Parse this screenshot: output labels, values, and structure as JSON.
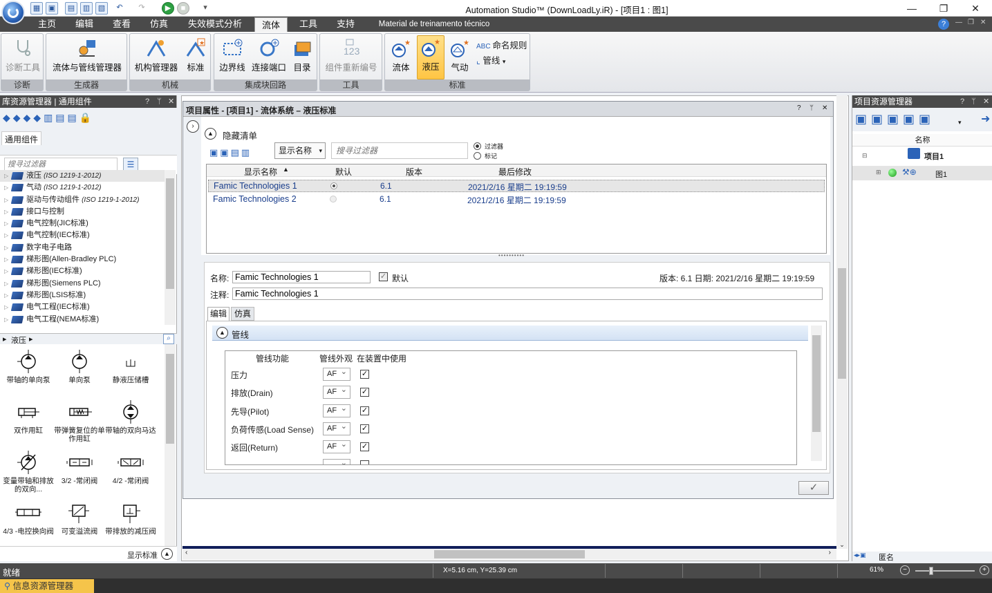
{
  "window": {
    "title": "Automation Studio™ (DownLoadLy.iR) - [项目1 : 图1]"
  },
  "menu": {
    "items": [
      "主页",
      "编辑",
      "查看",
      "仿真",
      "失效模式分析",
      "流体",
      "工具",
      "支持"
    ],
    "active_index": 5,
    "extra": "Material de treinamento técnico"
  },
  "ribbon": {
    "groups": [
      {
        "label": "诊断",
        "buttons": [
          {
            "label": "诊断工具",
            "disabled": true
          }
        ]
      },
      {
        "label": "生成器",
        "buttons": [
          {
            "label": "流体与管线管理器"
          }
        ]
      },
      {
        "label": "机械",
        "buttons": [
          {
            "label": "机构管理器"
          },
          {
            "label": "标准"
          }
        ]
      },
      {
        "label": "集成块回路",
        "buttons": [
          {
            "label": "边界线"
          },
          {
            "label": "连接端口"
          },
          {
            "label": "目录"
          }
        ]
      },
      {
        "label": "工具",
        "buttons": [
          {
            "label": "组件重新编号",
            "disabled": true
          }
        ]
      },
      {
        "label": "标准",
        "buttons": [
          {
            "label": "流体"
          },
          {
            "label": "液压",
            "selected": true
          },
          {
            "label": "气动"
          }
        ],
        "small": [
          "命名规则",
          "管线"
        ]
      }
    ]
  },
  "library": {
    "title": "库资源管理器 | 通用组件",
    "tab": "通用组件",
    "filter_placeholder": "搜寻过滤器",
    "items": [
      {
        "label": "液压",
        "tag": "(ISO 1219-1-2012)",
        "selected": true
      },
      {
        "label": "气动",
        "tag": "(ISO 1219-1-2012)"
      },
      {
        "label": "驱动与传动组件",
        "tag": "(ISO 1219-1-2012)"
      },
      {
        "label": "接口与控制",
        "tag": ""
      },
      {
        "label": "电气控制(JIC标准)",
        "tag": ""
      },
      {
        "label": "电气控制(IEC标准)",
        "tag": ""
      },
      {
        "label": "数字电子电路",
        "tag": ""
      },
      {
        "label": "梯形图(Allen-Bradley PLC)",
        "tag": ""
      },
      {
        "label": "梯形图(IEC标准)",
        "tag": ""
      },
      {
        "label": "梯形图(Siemens PLC)",
        "tag": ""
      },
      {
        "label": "梯形图(LSIS标准)",
        "tag": ""
      },
      {
        "label": "电气工程(IEC标准)",
        "tag": ""
      },
      {
        "label": "电气工程(NEMA标准)",
        "tag": ""
      }
    ],
    "path": "液压",
    "components": [
      "带轴的单向泵",
      "单向泵",
      "静液压储槽",
      "双作用缸",
      "带弹簧复位的单作用缸",
      "带轴的双向马达",
      "变量带轴和排放的双向...",
      "3/2 -常闭阀",
      "4/2 -常闭阀",
      "4/3 -电控换向阀",
      "可变溢流阀",
      "带排放的减压阀"
    ],
    "show_standard": "显示标准"
  },
  "props": {
    "title": "项目属性 - [项目1] - 流体系统 – 液压标准",
    "hide_list": "隐藏清单",
    "display_name_btn": "显示名称",
    "search_placeholder": "搜寻过滤器",
    "radio_filter": "过滤器",
    "radio_mark": "标记",
    "columns": [
      "显示名称",
      "默认",
      "版本",
      "最后修改"
    ],
    "rows": [
      {
        "name": "Famic Technologies 1",
        "version": "6.1",
        "modified": "2021/2/16 星期二 19:19:59",
        "default": true
      },
      {
        "name": "Famic Technologies 2",
        "version": "6.1",
        "modified": "2021/2/16 星期二 19:19:59",
        "default": false
      }
    ],
    "name_label": "名称:",
    "name_value": "Famic Technologies 1",
    "default_label": "默认",
    "version_info": "版本: 6.1 日期: 2021/2/16 星期二 19:19:59",
    "note_label": "注释:",
    "note_value": "Famic Technologies 1",
    "tabs": [
      "编辑",
      "仿真"
    ],
    "section": "管线",
    "line_cols": [
      "管线功能",
      "管线外观",
      "在装置中使用"
    ],
    "lines": [
      {
        "label": "压力",
        "look": "AF"
      },
      {
        "label": "排放(Drain)",
        "look": "AF"
      },
      {
        "label": "先导(Pilot)",
        "look": "AF"
      },
      {
        "label": "负荷传感(Load Sense)",
        "look": "AF"
      },
      {
        "label": "返回(Return)",
        "look": "AF"
      }
    ]
  },
  "project": {
    "title": "项目资源管理器",
    "col": "名称",
    "root": "项目1",
    "child": "图1",
    "footer": "匿名"
  },
  "status": {
    "ready": "就绪",
    "coords": "X=5.16 cm, Y=25.39 cm",
    "zoom": "61%"
  },
  "bottom": {
    "tab": "信息资源管理器"
  }
}
